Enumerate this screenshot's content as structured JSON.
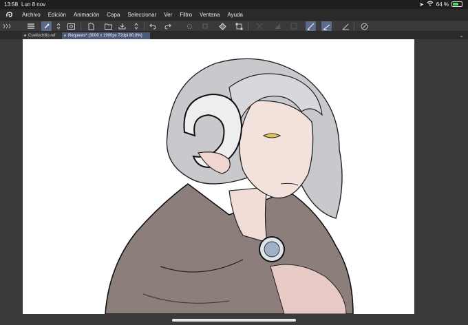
{
  "status": {
    "time": "13:58",
    "date": "Lun 8 nov",
    "battery": "64 %",
    "battery_level": 0.64
  },
  "menubar": {
    "items": [
      "Archivo",
      "Edición",
      "Animación",
      "Capa",
      "Seleccionar",
      "Ver",
      "Filtro",
      "Ventana",
      "Ayuda"
    ]
  },
  "tabs": [
    {
      "label": "Cuellochillo.ref"
    },
    {
      "label": "Requests* (3000 x 1900px 72dpi 80.8%)"
    }
  ],
  "colors": {
    "accent": "#5b6b8a",
    "tab_active": "#4a5a78",
    "cape": "#8c7f7b",
    "hair": "#c9c9cd",
    "skin": "#f1dcd6"
  }
}
